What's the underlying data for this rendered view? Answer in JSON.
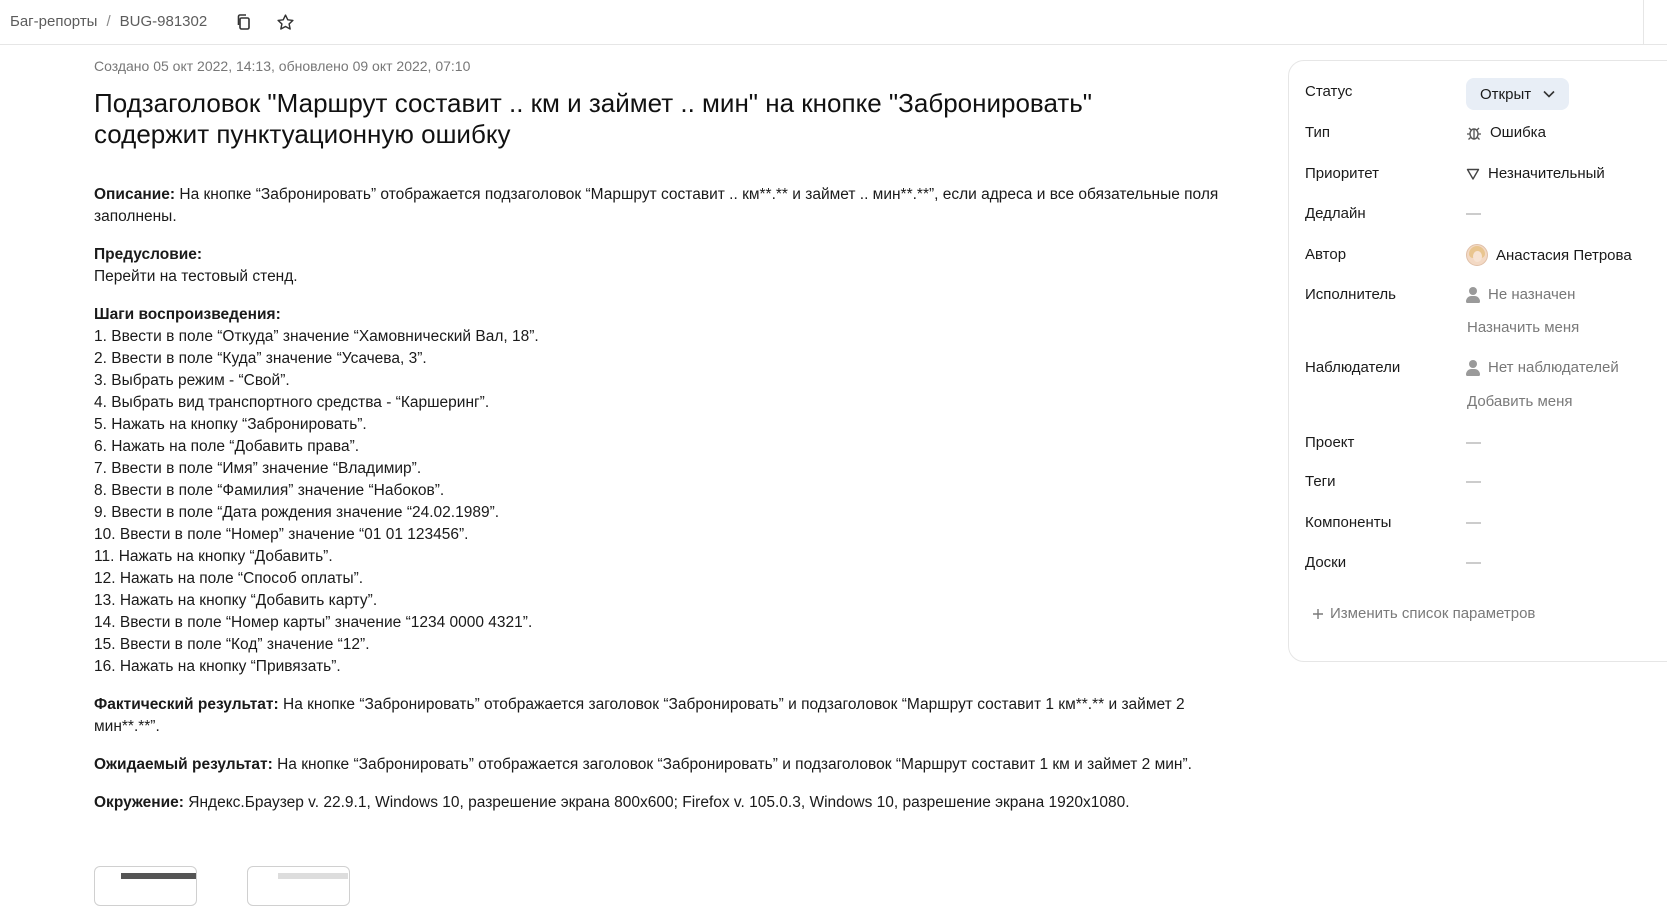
{
  "breadcrumb": {
    "section": "Баг-репорты",
    "separator": "/",
    "issue_key": "BUG-981302"
  },
  "issue": {
    "meta": "Создано 05 окт 2022, 14:13, обновлено 09 окт 2022, 07:10",
    "title": "Подзаголовок \"Маршрут составит .. км и займет .. мин\" на кнопке \"Забронировать\" содержит пунктуационную ошибку",
    "description_label": "Описание:",
    "description_text": " На кнопке “Забронировать” отображается подзаголовок “Маршрут составит .. км**.** и займет .. мин**.**”, если адреса и все обязательные поля заполнены.",
    "precondition_label": "Предусловие:",
    "precondition_text": "Перейти на тестовый стенд.",
    "steps_label": "Шаги воспроизведения:",
    "steps": [
      "1. Ввести в поле “Откуда” значение “Хамовнический Вал, 18”.",
      "2. Ввести в поле “Куда” значение “Усачева, 3”.",
      "3. Выбрать режим - “Свой”.",
      "4. Выбрать вид транспортного средства - “Каршеринг”.",
      "5. Нажать на кнопку “Забронировать”.",
      "6. Нажать на поле “Добавить права”.",
      "7. Ввести в поле “Имя” значение “Владимир”.",
      "8. Ввести в поле “Фамилия” значение “Набоков”.",
      "9. Ввести в поле “Дата рождения значение “24.02.1989”.",
      "10. Ввести в поле “Номер” значение “01 01 123456”.",
      "11. Нажать на кнопку “Добавить”.",
      "12. Нажать на поле “Способ оплаты”.",
      "13. Нажать на кнопку “Добавить карту”.",
      "14. Ввести в поле “Номер карты” значение “1234 0000 4321”.",
      "15. Ввести в поле “Код” значение “12”.",
      "16. Нажать на кнопку “Привязать”."
    ],
    "actual_label": "Фактический результат:",
    "actual_text": " На кнопке “Забронировать” отображается заголовок “Забронировать” и подзаголовок “Маршрут составит 1 км**.** и займет 2 мин**.**”.",
    "expected_label": "Ожидаемый результат:",
    "expected_text": " На кнопке “Забронировать” отображается заголовок “Забронировать” и подзаголовок “Маршрут составит 1 км и займет 2 мин”.",
    "env_label": "Окружение:",
    "env_text": " Яндекс.Браузер v. 22.9.1, Windows 10, разрешение экрана 800x600; Firefox v. 105.0.3, Windows 10, разрешение экрана 1920x1080."
  },
  "sidebar": {
    "status_label": "Статус",
    "status_value": "Открыт",
    "type_label": "Тип",
    "type_value": "Ошибка",
    "priority_label": "Приоритет",
    "priority_value": "Незначительный",
    "deadline_label": "Дедлайн",
    "deadline_value": "—",
    "author_label": "Автор",
    "author_value": "Анастасия Петрова",
    "assignee_label": "Исполнитель",
    "assignee_value": "Не назначен",
    "assign_me": "Назначить меня",
    "watchers_label": "Наблюдатели",
    "watchers_value": "Нет наблюдателей",
    "add_me": "Добавить меня",
    "project_label": "Проект",
    "project_value": "—",
    "tags_label": "Теги",
    "tags_value": "—",
    "components_label": "Компоненты",
    "components_value": "—",
    "boards_label": "Доски",
    "boards_value": "—",
    "change_params": "Изменить список параметров"
  }
}
